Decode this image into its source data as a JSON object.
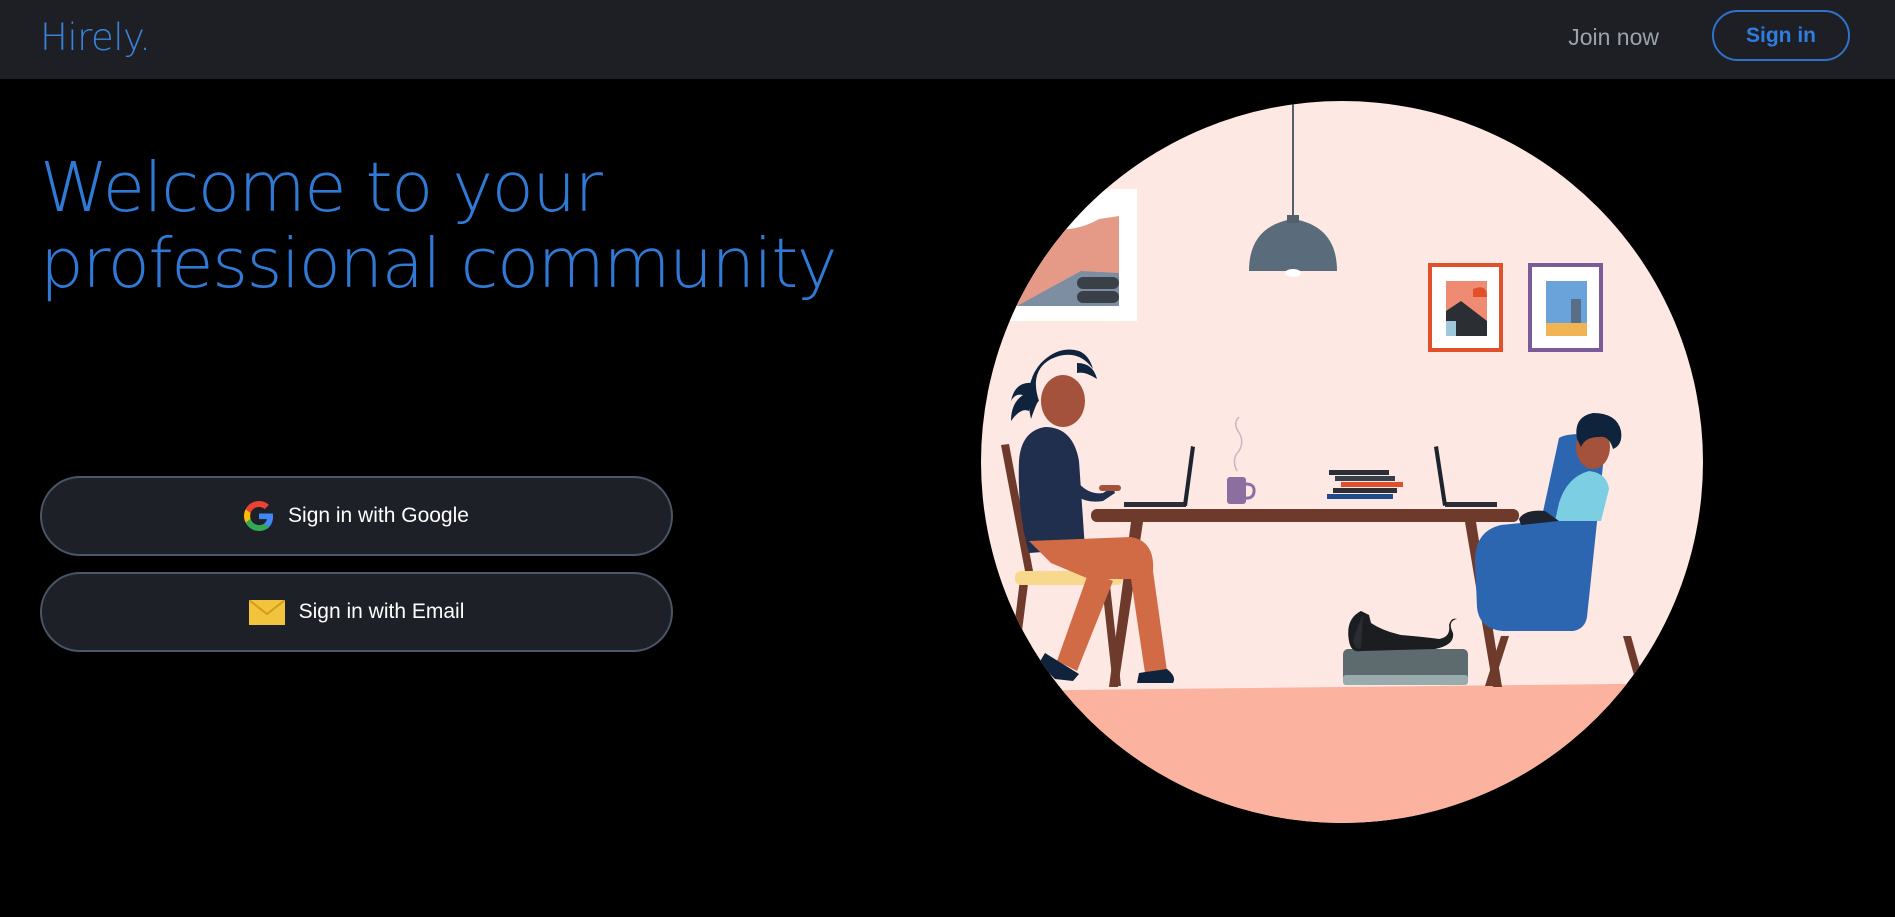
{
  "header": {
    "logo": "Hirely.",
    "join_label": "Join now",
    "signin_label": "Sign in"
  },
  "hero": {
    "headline_line1": "Welcome to your",
    "headline_line2": "professional community"
  },
  "auth": {
    "google_label": "Sign in with Google",
    "google_icon": "google-icon",
    "email_label": "Sign in with Email",
    "email_icon": "envelope-icon"
  },
  "colors": {
    "accent": "#2f7ad6",
    "topbar": "#1d1f24",
    "background": "#000000",
    "illustration_bg": "#fde8e3",
    "floor": "#fbb3a0"
  }
}
